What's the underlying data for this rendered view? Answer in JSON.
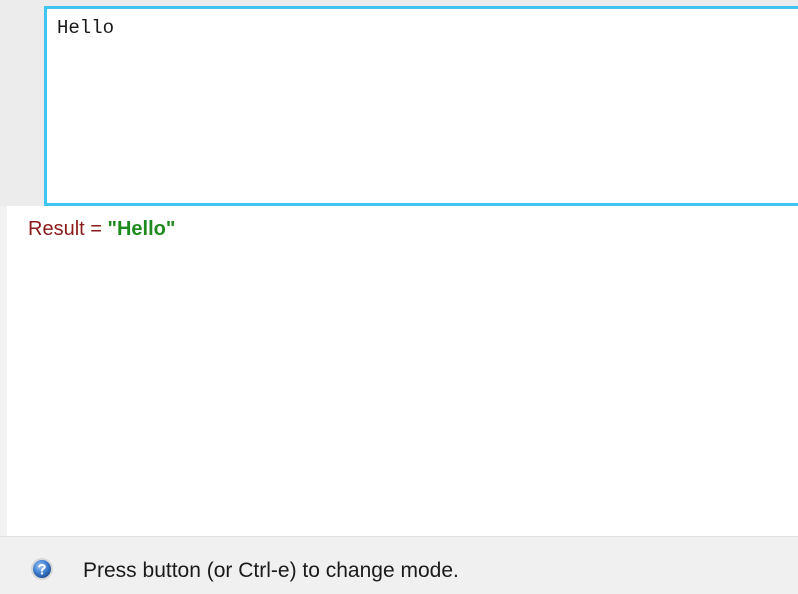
{
  "editor": {
    "input_value": "Hello"
  },
  "result": {
    "label": "Result = ",
    "value": "\"Hello\""
  },
  "status_bar": {
    "icon": "help-icon",
    "message": "Press button (or Ctrl-e) to change mode."
  },
  "colors": {
    "focus_border": "#3fc6f0",
    "result_label": "#8b1a1a",
    "result_value": "#1f8b1f"
  }
}
